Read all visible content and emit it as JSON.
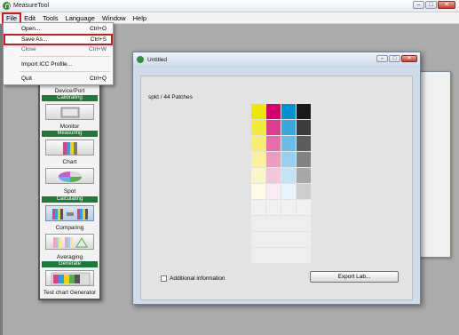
{
  "app": {
    "title": "MeasureTool"
  },
  "menubar": {
    "items": [
      "File",
      "Edit",
      "Tools",
      "Language",
      "Window",
      "Help"
    ]
  },
  "file_menu": [
    {
      "label": "Open...",
      "shortcut": "Ctrl+O"
    },
    {
      "label": "Save As...",
      "shortcut": "Ctrl+S"
    },
    {
      "label": "Close",
      "shortcut": "Ctrl+W"
    },
    {
      "label": "Import ICC Profile...",
      "shortcut": ""
    },
    {
      "label": "Quit",
      "shortcut": "Ctrl+Q"
    }
  ],
  "palette": {
    "top_label": "Device/Port",
    "sections": {
      "calibrating": "Calibrating",
      "measuring": "Measuring",
      "calculating": "Calculating",
      "generate": "Generate"
    },
    "labels": {
      "monitor": "Monitor",
      "chart": "Chart",
      "spot": "Spot",
      "comparing": "Comparing",
      "averaging": "Averaging",
      "test_chart_generator": "Test chart Generator"
    }
  },
  "document": {
    "title": "Untitled",
    "patches_label": "spkt / 44 Patches",
    "additional_info": "Additional information",
    "export_button": "Export Lab...",
    "columns": [
      [
        "#f2e600",
        "#f4ea3a",
        "#f6ee6e",
        "#f8f29c",
        "#fbf6c8",
        "#fdfbe8",
        "#f1f1f1"
      ],
      [
        "#d4006e",
        "#dc3d8c",
        "#e56ea8",
        "#ec9cc3",
        "#f3c6dc",
        "#faeaf2",
        "#f1f1f1"
      ],
      [
        "#0091d2",
        "#3aa8dd",
        "#6cbde6",
        "#98d1ee",
        "#c2e3f5",
        "#e6f4fb",
        "#f1f1f1"
      ],
      [
        "#1a1a1a",
        "#3b3b3b",
        "#5d5d5d",
        "#828282",
        "#a8a8a8",
        "#cecece",
        "#f1f1f1"
      ]
    ]
  },
  "colors": {
    "brand_green": "#1e7a3b",
    "highlight_red": "#d11a1a"
  }
}
